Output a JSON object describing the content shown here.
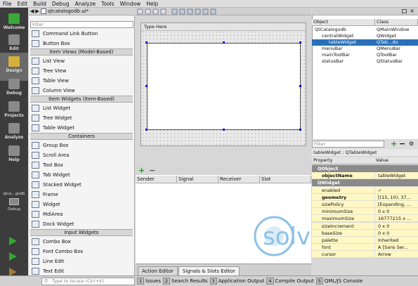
{
  "menu": [
    "File",
    "Edit",
    "Build",
    "Debug",
    "Analyze",
    "Tools",
    "Window",
    "Help"
  ],
  "modes": [
    {
      "label": "Welcome",
      "icon": "qt-logo-icon"
    },
    {
      "label": "Edit",
      "icon": "edit-icon"
    },
    {
      "label": "Design",
      "icon": "design-icon"
    },
    {
      "label": "Debug",
      "icon": "debug-icon"
    },
    {
      "label": "Projects",
      "icon": "projects-icon"
    },
    {
      "label": "Analyze",
      "icon": "analyze-icon"
    },
    {
      "label": "Help",
      "icon": "help-icon"
    }
  ],
  "session": {
    "project": "qtca...godb",
    "build": "Debug"
  },
  "document": {
    "tab": "qtcatalogodb.ui*"
  },
  "widgetbox": {
    "filter_placeholder": "Filter",
    "items": [
      {
        "type": "item",
        "label": "Command Link Button"
      },
      {
        "type": "item",
        "label": "Button Box"
      },
      {
        "type": "cat",
        "label": "Item Views (Model-Based)"
      },
      {
        "type": "item",
        "label": "List View"
      },
      {
        "type": "item",
        "label": "Tree View"
      },
      {
        "type": "item",
        "label": "Table View"
      },
      {
        "type": "item",
        "label": "Column View"
      },
      {
        "type": "cat",
        "label": "Item Widgets (Item-Based)"
      },
      {
        "type": "item",
        "label": "List Widget"
      },
      {
        "type": "item",
        "label": "Tree Widget"
      },
      {
        "type": "item",
        "label": "Table Widget"
      },
      {
        "type": "cat",
        "label": "Containers"
      },
      {
        "type": "item",
        "label": "Group Box"
      },
      {
        "type": "item",
        "label": "Scroll Area"
      },
      {
        "type": "item",
        "label": "Tool Box"
      },
      {
        "type": "item",
        "label": "Tab Widget"
      },
      {
        "type": "item",
        "label": "Stacked Widget"
      },
      {
        "type": "item",
        "label": "Frame"
      },
      {
        "type": "item",
        "label": "Widget"
      },
      {
        "type": "item",
        "label": "MdiArea"
      },
      {
        "type": "item",
        "label": "Dock Widget"
      },
      {
        "type": "cat",
        "label": "Input Widgets"
      },
      {
        "type": "item",
        "label": "Combo Box"
      },
      {
        "type": "item",
        "label": "Font Combo Box"
      },
      {
        "type": "item",
        "label": "Line Edit"
      },
      {
        "type": "item",
        "label": "Text Edit"
      }
    ]
  },
  "form": {
    "menu_placeholder": "Type Here"
  },
  "signals": {
    "columns": [
      "Sender",
      "Signal",
      "Receiver",
      "Slot"
    ],
    "tabs": [
      "Action Editor",
      "Signals & Slots Editor"
    ]
  },
  "object_inspector": {
    "columns": [
      "Object",
      "Class"
    ],
    "rows": [
      {
        "object": "QtCatalogodb",
        "class": "QMainWindow",
        "indent": 0,
        "selected": false
      },
      {
        "object": "centralWidget",
        "class": "QWidget",
        "indent": 1,
        "selected": false
      },
      {
        "object": "tableWidget",
        "class": "QTab...do",
        "indent": 2,
        "selected": true
      },
      {
        "object": "menuBar",
        "class": "QMenuBar",
        "indent": 1,
        "selected": false
      },
      {
        "object": "mainToolBar",
        "class": "QToolBar",
        "indent": 1,
        "selected": false
      },
      {
        "object": "statusBar",
        "class": "QStatusBar",
        "indent": 1,
        "selected": false
      }
    ]
  },
  "property_editor": {
    "filter_placeholder": "Filter",
    "label": "tableWidget : QTableWidget",
    "columns": [
      "Property",
      "Value"
    ],
    "rows": [
      {
        "group": true,
        "name": "QObject"
      },
      {
        "name": "objectName",
        "value": "tableWidget",
        "bold": true,
        "color": "#fff7c4"
      },
      {
        "group": true,
        "name": "QWidget"
      },
      {
        "name": "enabled",
        "value": "✓",
        "color": "#fff7c4"
      },
      {
        "name": "geometry",
        "value": "[(15, 10), 37...",
        "bold": true,
        "color": "#fff7c4"
      },
      {
        "name": "sizePolicy",
        "value": "[Expanding, ...",
        "color": "#fff7c4"
      },
      {
        "name": "minimumSize",
        "value": "0 x 0",
        "color": "#fff7c4"
      },
      {
        "name": "maximumSize",
        "value": "16777215 x ...",
        "color": "#fff7c4"
      },
      {
        "name": "sizeIncrement",
        "value": "0 x 0",
        "color": "#fff7c4"
      },
      {
        "name": "baseSize",
        "value": "0 x 0",
        "color": "#fff7c4"
      },
      {
        "name": "palette",
        "value": "Inherited",
        "color": "#fff7c4"
      },
      {
        "name": "font",
        "value": "A [Sans Ser...",
        "color": "#fff7c4"
      },
      {
        "name": "cursor",
        "value": "Arrow",
        "color": "#fff7c4"
      }
    ]
  },
  "statusbar": {
    "locate_placeholder": "Type to locate (Ctrl+K)",
    "panes": [
      {
        "n": "1",
        "label": "Issues"
      },
      {
        "n": "2",
        "label": "Search Results"
      },
      {
        "n": "3",
        "label": "Application Output"
      },
      {
        "n": "4",
        "label": "Compile Output"
      },
      {
        "n": "5",
        "label": "QML/JS Console"
      }
    ]
  },
  "watermark": {
    "text": "solvetic",
    ".com": ".com"
  },
  "colors": {
    "accent": "#2a70b8",
    "selection": "#2a70b8",
    "modebar": "#3c3c3c",
    "watermark": "#2e8fd4"
  }
}
